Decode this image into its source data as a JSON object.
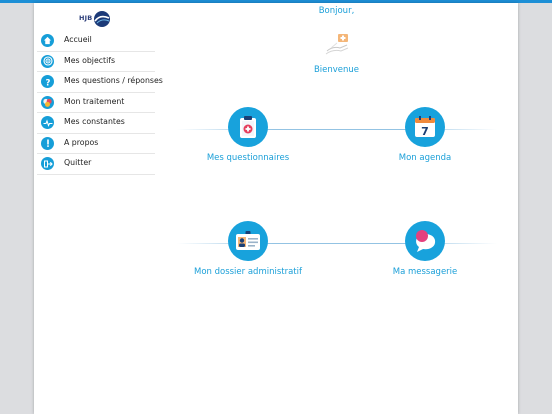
{
  "app": {
    "logo_text": "HJB"
  },
  "sidebar": {
    "items": [
      {
        "label": "Accueil",
        "icon": "home-icon"
      },
      {
        "label": "Mes objectifs",
        "icon": "target-icon"
      },
      {
        "label": "Mes questions / réponses",
        "icon": "question-icon"
      },
      {
        "label": "Mon traitement",
        "icon": "pills-icon"
      },
      {
        "label": "Mes constantes",
        "icon": "pulse-icon"
      },
      {
        "label": "A propos",
        "icon": "info-icon"
      },
      {
        "label": "Quitter",
        "icon": "exit-icon"
      }
    ]
  },
  "main": {
    "greeting": "Bonjour,",
    "welcome": "Bienvenue",
    "tiles": [
      {
        "label": "Mes questionnaires",
        "icon": "clipboard-icon"
      },
      {
        "label": "Mon agenda",
        "icon": "calendar-icon",
        "calendar_day": "7"
      },
      {
        "label": "Mon dossier administratif",
        "icon": "id-card-icon"
      },
      {
        "label": "Ma messagerie",
        "icon": "chat-bubble-icon"
      }
    ]
  },
  "colors": {
    "accent": "#18a2dc",
    "topbar": "#1d8fd6"
  }
}
